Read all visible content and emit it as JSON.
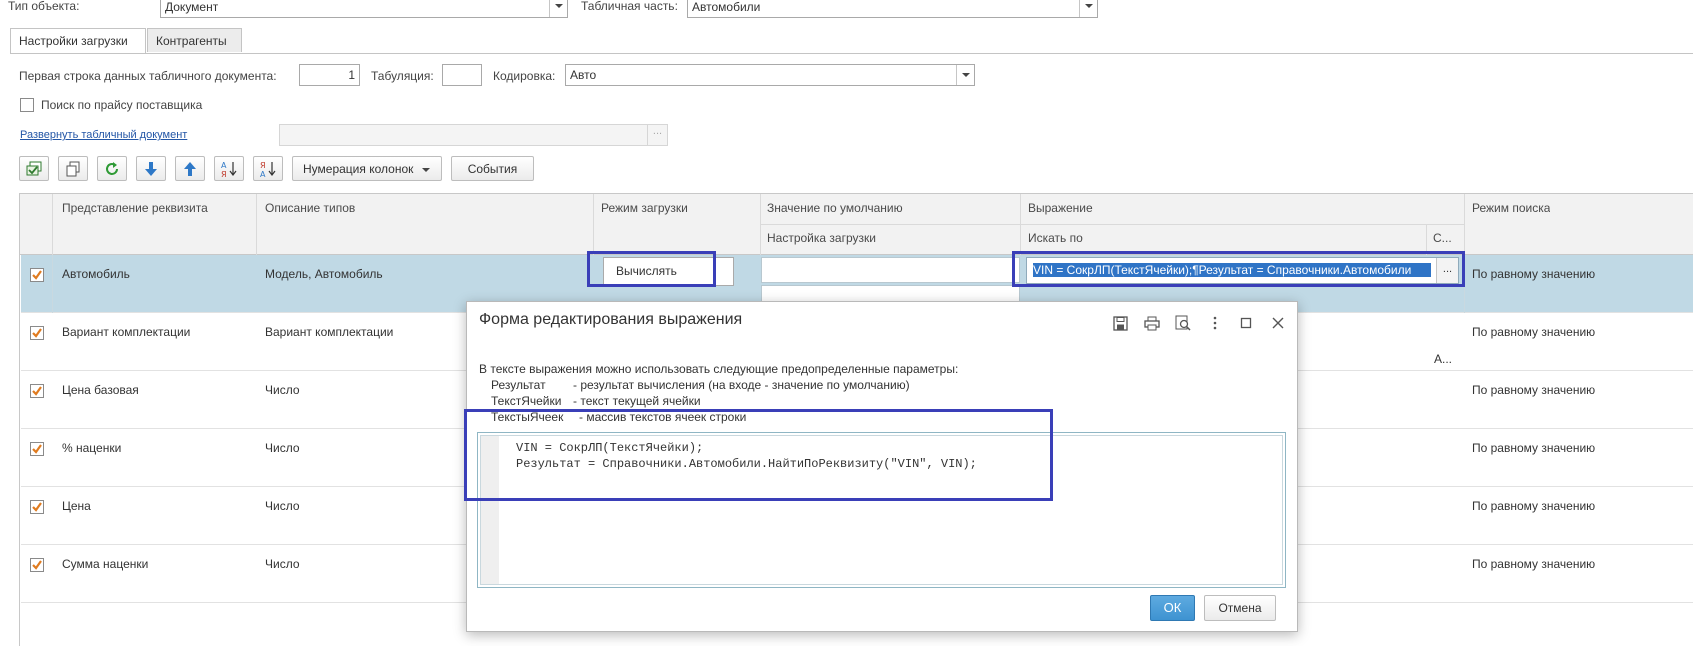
{
  "top": {
    "object_type_label": "Тип объекта:",
    "object_type_value": "Документ",
    "table_part_label": "Табличная часть:",
    "table_part_value": "Автомобили"
  },
  "tabs": [
    {
      "label": "Настройки загрузки",
      "active": true
    },
    {
      "label": "Контрагенты",
      "active": false
    }
  ],
  "settings": {
    "first_row_label": "Первая строка данных табличного документа:",
    "first_row_value": "1",
    "tab_label": "Табуляция:",
    "tab_value": "",
    "encoding_label": "Кодировка:",
    "encoding_value": "Авто",
    "price_search_label": "Поиск по прайсу поставщика",
    "price_search_checked": false,
    "expand_link": "Развернуть табличный документ",
    "expand_field_value": "",
    "expand_field_button": "..."
  },
  "toolbar": {
    "icons": [
      "select-all-icon",
      "copy-icon",
      "refresh-icon",
      "move-down-icon",
      "move-up-icon",
      "sort-asc-icon",
      "sort-desc-icon"
    ],
    "numbering_label": "Нумерация колонок",
    "events_label": "События"
  },
  "grid": {
    "headers": {
      "attribute": "Представление реквизита",
      "types": "Описание типов",
      "load_mode": "Режим загрузки",
      "default_value": "Значение по умолчанию",
      "load_settings": "Настройка загрузки",
      "expression": "Выражение",
      "search_by": "Искать по",
      "c": "С...",
      "search_mode": "Режим поиска"
    },
    "rows": [
      {
        "checked": true,
        "attribute": "Автомобиль",
        "types": "Модель, Автомобиль",
        "load_mode": "Вычислять",
        "expression": "VIN = СокрЛП(ТекстЯчейки);¶Результат = Справочники.Автомобили",
        "expression_button": "...",
        "extra": "",
        "search_mode": "По равному значению"
      },
      {
        "checked": true,
        "attribute": "Вариант комплектации",
        "types": "Вариант комплектации",
        "load_mode": "",
        "expression": "",
        "expression_button": "",
        "extra": "А...",
        "search_mode": "По равному значению"
      },
      {
        "checked": true,
        "attribute": "Цена базовая",
        "types": "Число",
        "load_mode": "",
        "expression": "",
        "expression_button": "",
        "extra": "",
        "search_mode": "По равному значению"
      },
      {
        "checked": true,
        "attribute": "% наценки",
        "types": "Число",
        "load_mode": "",
        "expression": "",
        "expression_button": "",
        "extra": "",
        "search_mode": "По равному значению"
      },
      {
        "checked": true,
        "attribute": "Цена",
        "types": "Число",
        "load_mode": "",
        "expression": "",
        "expression_button": "",
        "extra": "",
        "search_mode": "По равному значению"
      },
      {
        "checked": true,
        "attribute": "Сумма наценки",
        "types": "Число",
        "load_mode": "",
        "expression": "",
        "expression_button": "",
        "extra": "",
        "search_mode": "По равному значению"
      }
    ]
  },
  "dialog": {
    "title": "Форма редактирования выражения",
    "header_icons": [
      "save-icon",
      "print-icon",
      "preview-icon",
      "more-icon",
      "maximize-icon",
      "close-icon"
    ],
    "help_intro": "В тексте выражения можно использовать следующие предопределенные параметры:",
    "help_lines": [
      {
        "name": "Результат",
        "desc": "- результат вычисления (на входе - значение по умолчанию)"
      },
      {
        "name": "ТекстЯчейки",
        "desc": "- текст текущей ячейки"
      },
      {
        "name": "ТекстыЯчеек",
        "desc": "- массив текстов ячеек строки"
      }
    ],
    "code_lines": [
      "VIN = СокрЛП(ТекстЯчейки);",
      "Результат = Справочники.Автомобили.НайтиПоРеквизиту(\"VIN\", VIN);"
    ],
    "ok_label": "ОК",
    "cancel_label": "Отмена"
  },
  "colors": {
    "accent_highlight": "#3a3fb8",
    "selected_row": "#c0d9e5",
    "selected_text_bg": "#2f74c6",
    "checkbox_check": "#e07b1f",
    "ok_button": "#3e93d1",
    "link": "#2356a6"
  }
}
